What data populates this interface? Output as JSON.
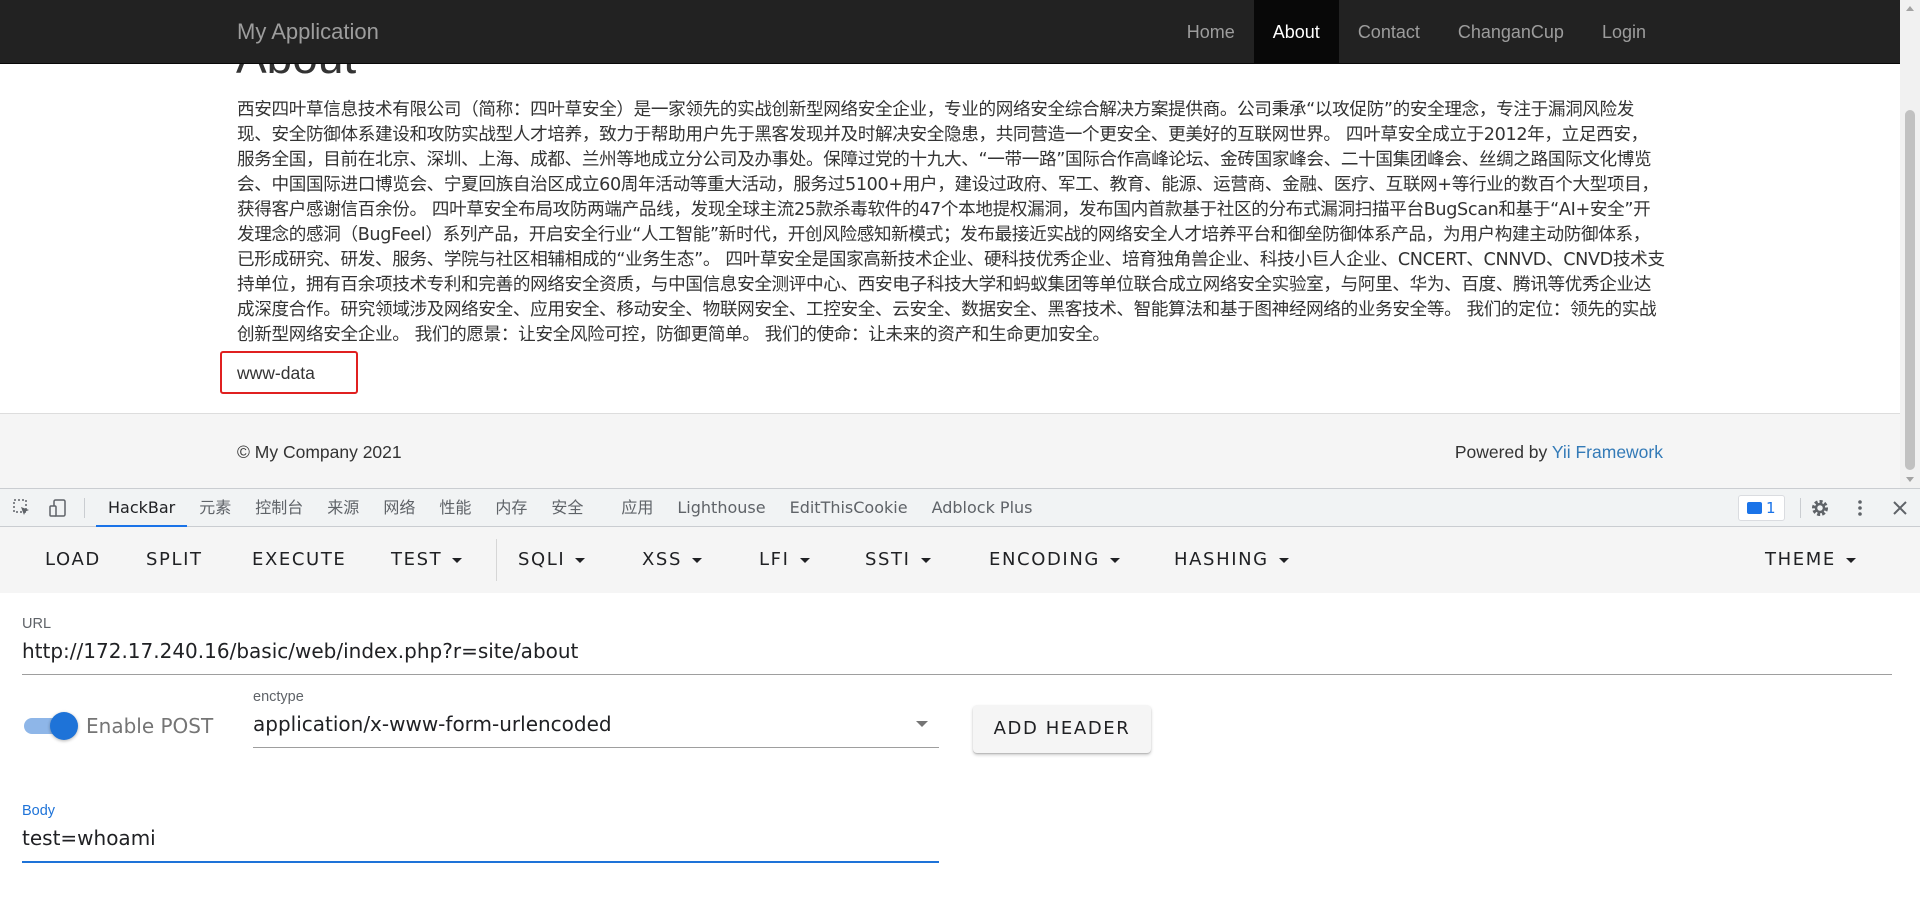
{
  "app": {
    "brand": "My Application"
  },
  "nav": {
    "items": [
      {
        "label": "Home",
        "active": false
      },
      {
        "label": "About",
        "active": true
      },
      {
        "label": "Contact",
        "active": false
      },
      {
        "label": "ChanganCup",
        "active": false
      },
      {
        "label": "Login",
        "active": false
      }
    ]
  },
  "content": {
    "title": "About",
    "body": "西安四叶草信息技术有限公司（简称：四叶草安全）是一家领先的实战创新型网络安全企业，专业的网络安全综合解决方案提供商。公司秉承“以攻促防”的安全理念，专注于漏洞风险发现、安全防御体系建设和攻防实战型人才培养，致力于帮助用户先于黑客发现并及时解决安全隐患，共同营造一个更安全、更美好的互联网世界。 四叶草安全成立于2012年，立足西安，服务全国，目前在北京、深圳、上海、成都、兰州等地成立分公司及办事处。保障过党的十九大、“一带一路”国际合作高峰论坛、金砖国家峰会、二十国集团峰会、丝绸之路国际文化博览会、中国国际进口博览会、宁夏回族自治区成立60周年活动等重大活动，服务过5100+用户，建设过政府、军工、教育、能源、运营商、金融、医疗、互联网+等行业的数百个大型项目，获得客户感谢信百余份。 四叶草安全布局攻防两端产品线，发现全球主流25款杀毒软件的47个本地提权漏洞，发布国内首款基于社区的分布式漏洞扫描平台BugScan和基于“AI+安全”开发理念的感洞（BugFeel）系列产品，开启安全行业“人工智能”新时代，开创风险感知新模式；发布最接近实战的网络安全人才培养平台和御垒防御体系产品，为用户构建主动防御体系，已形成研究、研发、服务、学院与社区相辅相成的“业务生态”。 四叶草安全是国家高新技术企业、硬科技优秀企业、培育独角兽企业、科技小巨人企业、CNCERT、CNNVD、CNVD技术支持单位，拥有百余项技术专利和完善的网络安全资质，与中国信息安全测评中心、西安电子科技大学和蚂蚁集团等单位联合成立网络安全实验室，与阿里、华为、百度、腾讯等优秀企业达成深度合作。研究领域涉及网络安全、应用安全、移动安全、物联网安全、工控安全、云安全、数据安全、黑客技术、智能算法和基于图神经网络的业务安全等。 我们的定位：领先的实战创新型网络安全企业。 我们的愿景：让安全风险可控，防御更简单。 我们的使命：让未来的资产和生命更加安全。",
    "command_output": "www-data"
  },
  "footer": {
    "copyright": "© My Company 2021",
    "powered_prefix": "Powered by ",
    "powered_link": "Yii Framework"
  },
  "devtools": {
    "tabs": [
      {
        "label": "HackBar",
        "active": true
      },
      {
        "label": "元素",
        "active": false
      },
      {
        "label": "控制台",
        "active": false
      },
      {
        "label": "来源",
        "active": false
      },
      {
        "label": "网络",
        "active": false
      },
      {
        "label": "性能",
        "active": false
      },
      {
        "label": "内存",
        "active": false
      },
      {
        "label": "安全",
        "active": false
      },
      {
        "label": "应用",
        "active": false
      },
      {
        "label": "Lighthouse",
        "active": false
      },
      {
        "label": "EditThisCookie",
        "active": false
      },
      {
        "label": "Adblock Plus",
        "active": false
      }
    ],
    "issues_count": "1",
    "icons": [
      "inspect-element-icon",
      "device-toolbar-icon",
      "chat-icon",
      "gear-icon",
      "more-vert-icon",
      "close-icon"
    ]
  },
  "hackbar": {
    "toolbar": {
      "load": "LOAD",
      "split": "SPLIT",
      "execute": "EXECUTE",
      "test": "TEST",
      "sqli": "SQLI",
      "xss": "XSS",
      "lfi": "LFI",
      "ssti": "SSTI",
      "encoding": "ENCODING",
      "hashing": "HASHING",
      "theme": "THEME"
    },
    "url_label": "URL",
    "url": "http://172.17.240.16/basic/web/index.php?r=site/about",
    "post_toggle_label": "Enable POST",
    "post_enabled": true,
    "enctype_label": "enctype",
    "enctype": "application/x-www-form-urlencoded",
    "add_header": "ADD HEADER",
    "body_label": "Body",
    "body": "test=whoami"
  },
  "colors": {
    "navbar_bg": "#222222",
    "link": "#337ab7",
    "highlight_box": "#e02020",
    "accent": "#1e73d8"
  }
}
